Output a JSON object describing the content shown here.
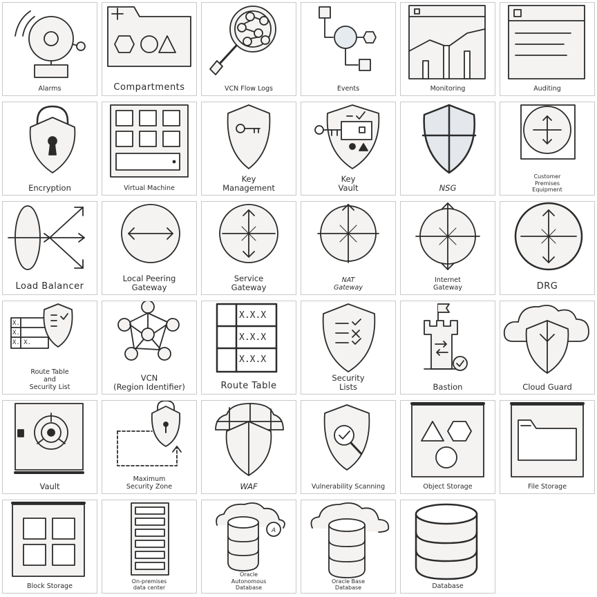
{
  "tiles": [
    {
      "label": "Alarms",
      "icon": "alarm-bell-icon"
    },
    {
      "label": "Compartments",
      "icon": "folder-shapes-icon"
    },
    {
      "label": "VCN Flow Logs",
      "icon": "magnifier-network-icon"
    },
    {
      "label": "Events",
      "icon": "event-flow-icon"
    },
    {
      "label": "Monitoring",
      "icon": "monitor-chart-icon"
    },
    {
      "label": "Auditing",
      "icon": "audit-document-icon"
    },
    {
      "label": "Encryption",
      "icon": "padlock-icon"
    },
    {
      "label": "Virtual Machine",
      "icon": "virtual-machine-icon"
    },
    {
      "label": "Key\nManagement",
      "icon": "key-shield-icon"
    },
    {
      "label": "Key\nVault",
      "icon": "key-vault-icon"
    },
    {
      "label": "NSG",
      "icon": "nsg-shield-icon"
    },
    {
      "label": "Customer\nPremises\nEquipment",
      "icon": "cpe-router-icon"
    },
    {
      "label": "Load Balancer",
      "icon": "load-balancer-icon"
    },
    {
      "label": "Local Peering\nGateway",
      "icon": "local-peering-gateway-icon"
    },
    {
      "label": "Service\nGateway",
      "icon": "service-gateway-icon"
    },
    {
      "label": "NAT\nGateway",
      "icon": "nat-gateway-icon"
    },
    {
      "label": "Internet\nGateway",
      "icon": "internet-gateway-icon"
    },
    {
      "label": "DRG",
      "icon": "drg-router-icon"
    },
    {
      "label": "Route Table\nand\nSecurity List",
      "icon": "route-table-shield-icon",
      "cells": [
        "X.",
        "X.",
        "X. X."
      ]
    },
    {
      "label": "VCN\n(Region Identifier)",
      "icon": "vcn-network-icon"
    },
    {
      "label": "Route Table",
      "icon": "route-table-icon",
      "cells": [
        "X.X.X",
        "X.X.X",
        "X.X.X"
      ]
    },
    {
      "label": "Security\nLists",
      "icon": "security-list-shield-icon"
    },
    {
      "label": "Bastion",
      "icon": "bastion-tower-icon"
    },
    {
      "label": "Cloud Guard",
      "icon": "cloud-guard-icon"
    },
    {
      "label": "Vault",
      "icon": "vault-safe-icon"
    },
    {
      "label": "Maximum\nSecurity Zone",
      "icon": "security-zone-icon"
    },
    {
      "label": "WAF",
      "icon": "waf-firewall-icon"
    },
    {
      "label": "Vulnerability Scanning",
      "icon": "vulnerability-scan-icon"
    },
    {
      "label": "Object Storage",
      "icon": "object-storage-icon"
    },
    {
      "label": "File Storage",
      "icon": "file-storage-icon"
    },
    {
      "label": "Block Storage",
      "icon": "block-storage-icon"
    },
    {
      "label": "On-premises\ndata center",
      "icon": "data-center-icon"
    },
    {
      "label": "Oracle\nAutonomous\nDatabase",
      "icon": "autonomous-database-icon",
      "badge": "A"
    },
    {
      "label": "Oracle Base\nDatabase",
      "icon": "base-database-icon"
    },
    {
      "label": "Database",
      "icon": "database-icon"
    }
  ],
  "colors": {
    "stroke": "#2b2b2b",
    "fill": "#f4f3f1",
    "accent": "#e6ebf0",
    "border": "#c9c9c9"
  }
}
